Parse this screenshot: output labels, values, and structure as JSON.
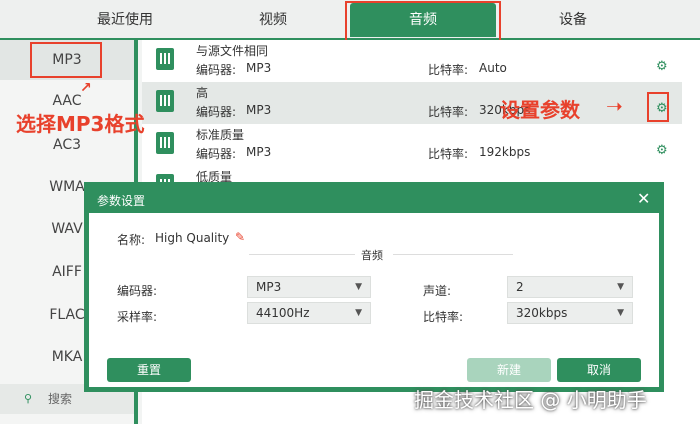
{
  "tabs": [
    "最近使用",
    "视频",
    "音频",
    "设备"
  ],
  "formats": [
    "MP3",
    "AAC",
    "AC3",
    "WMA",
    "WAV",
    "AIFF",
    "FLAC",
    "MKA"
  ],
  "search_label": "搜索",
  "presets": [
    {
      "name": "与源文件相同",
      "encoder_label": "编码器:",
      "encoder": "MP3",
      "bitrate_label": "比特率:",
      "bitrate": "Auto"
    },
    {
      "name": "高",
      "encoder_label": "编码器:",
      "encoder": "MP3",
      "bitrate_label": "比特率:",
      "bitrate": "320kbps"
    },
    {
      "name": "标准质量",
      "encoder_label": "编码器:",
      "encoder": "MP3",
      "bitrate_label": "比特率:",
      "bitrate": "192kbps"
    },
    {
      "name": "低质量"
    }
  ],
  "annotations": {
    "select_format": "选择MP3格式",
    "set_params": "设置参数"
  },
  "dialog": {
    "title": "参数设置",
    "name_label": "名称:",
    "name_value": "High Quality",
    "section": "音频",
    "encoder_label": "编码器:",
    "encoder_value": "MP3",
    "sample_label": "采样率:",
    "sample_value": "44100Hz",
    "channel_label": "声道:",
    "channel_value": "2",
    "bitrate_label": "比特率:",
    "bitrate_value": "320kbps",
    "reset": "重置",
    "new": "新建",
    "cancel": "取消"
  },
  "watermark": "掘金技术社区 @ 小明助手",
  "colors": {
    "accent": "#2f8f5e",
    "annotation": "#e8412c"
  },
  "icons": [
    "close-icon",
    "edit-icon",
    "gear-icon",
    "chevron-down-icon",
    "search-icon",
    "audio-file-icon"
  ]
}
